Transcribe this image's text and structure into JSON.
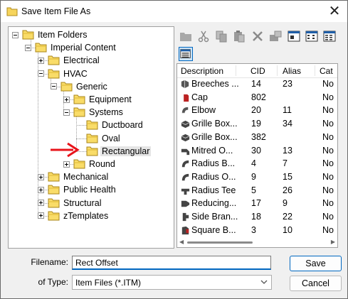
{
  "window": {
    "title": "Save Item File As",
    "accent": "#0067c0"
  },
  "tree": {
    "nodes": [
      {
        "label": "Item Folders"
      },
      {
        "label": "Imperial Content"
      },
      {
        "label": "Electrical"
      },
      {
        "label": "HVAC"
      },
      {
        "label": "Generic"
      },
      {
        "label": "Equipment"
      },
      {
        "label": "Systems"
      },
      {
        "label": "Ductboard"
      },
      {
        "label": "Oval"
      },
      {
        "label": "Rectangular",
        "selected": true
      },
      {
        "label": "Round"
      },
      {
        "label": "Mechanical"
      },
      {
        "label": "Public Health"
      },
      {
        "label": "Structural"
      },
      {
        "label": "zTemplates"
      }
    ],
    "annotation_color": "#e8141b"
  },
  "toolbar": {
    "buttons": [
      "new-folder-icon",
      "cut-icon",
      "copy-icon",
      "paste-icon",
      "delete-icon",
      "properties-icon",
      "large-icons-view-icon",
      "small-icons-view-icon",
      "list-view-icon",
      "details-view-icon"
    ]
  },
  "list": {
    "columns": [
      "Description",
      "CID",
      "Alias",
      "Cat"
    ],
    "rows": [
      {
        "desc": "Breeches ...",
        "cid": "14",
        "alias": "23",
        "cat": "No"
      },
      {
        "desc": "Cap",
        "cid": "802",
        "alias": "",
        "cat": "No"
      },
      {
        "desc": "Elbow",
        "cid": "20",
        "alias": "11",
        "cat": "No"
      },
      {
        "desc": "Grille Box...",
        "cid": "19",
        "alias": "34",
        "cat": "No"
      },
      {
        "desc": "Grille Box...",
        "cid": "382",
        "alias": "",
        "cat": "No"
      },
      {
        "desc": "Mitred O...",
        "cid": "30",
        "alias": "13",
        "cat": "No"
      },
      {
        "desc": "Radius B...",
        "cid": "4",
        "alias": "7",
        "cat": "No"
      },
      {
        "desc": "Radius O...",
        "cid": "9",
        "alias": "15",
        "cat": "No"
      },
      {
        "desc": "Radius Tee",
        "cid": "5",
        "alias": "26",
        "cat": "No"
      },
      {
        "desc": "Reducing...",
        "cid": "17",
        "alias": "9",
        "cat": "No"
      },
      {
        "desc": "Side Bran...",
        "cid": "18",
        "alias": "22",
        "cat": "No"
      },
      {
        "desc": "Square B...",
        "cid": "3",
        "alias": "10",
        "cat": "No"
      }
    ]
  },
  "form": {
    "filename_label": "Filename:",
    "filename_value": "Rect Offset",
    "type_label": "of Type:",
    "type_value": "Item Files (*.ITM)"
  },
  "buttons": {
    "save": "Save",
    "cancel": "Cancel"
  }
}
